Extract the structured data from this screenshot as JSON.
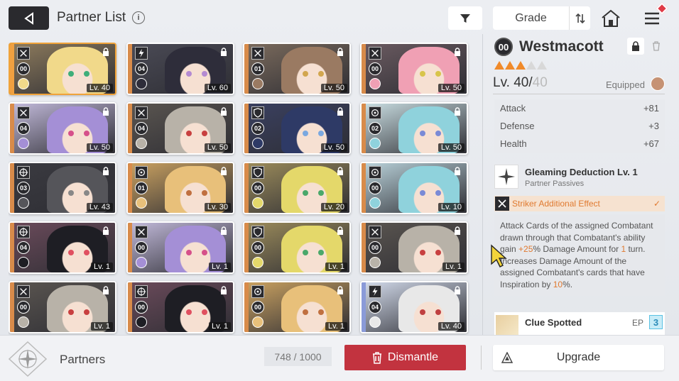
{
  "header": {
    "title": "Partner List",
    "info_symbol": "i",
    "sort_label": "Grade"
  },
  "partners": [
    {
      "grade": "00",
      "level": "Lv. 40",
      "stripe": "#f0a040",
      "hair": "#f1d98a",
      "eye": "#3fae7a",
      "bg": "#8c7a5c",
      "selected": true,
      "type": "x"
    },
    {
      "grade": "04",
      "level": "Lv. 60",
      "stripe": "#d88b4a",
      "hair": "#2e2d3a",
      "eye": "#b48ad2",
      "bg": "#4a4a55",
      "type": "bolt"
    },
    {
      "grade": "01",
      "level": "Lv. 50",
      "stripe": "#d88b4a",
      "hair": "#9a7a62",
      "eye": "#d2a64e",
      "bg": "#7a6a5c",
      "type": "x"
    },
    {
      "grade": "00",
      "level": "Lv. 50",
      "stripe": "#d88b4a",
      "hair": "#f0a0b4",
      "eye": "#d8c44a",
      "bg": "#6a5a60",
      "type": "x"
    },
    {
      "grade": "04",
      "level": "Lv. 50",
      "stripe": "#d88b4a",
      "hair": "#a48fd6",
      "eye": "#d6508a",
      "bg": "#c0b8d8",
      "type": "x"
    },
    {
      "grade": "04",
      "level": "Lv. 50",
      "stripe": "#d88b4a",
      "hair": "#b8b2a8",
      "eye": "#c84040",
      "bg": "#5a5550",
      "type": "x"
    },
    {
      "grade": "02",
      "level": "Lv. 50",
      "stripe": "#d88b4a",
      "hair": "#2e3a66",
      "eye": "#7aa8e0",
      "bg": "#3a4060",
      "type": "shield"
    },
    {
      "grade": "02",
      "level": "Lv. 50",
      "stripe": "#d88b4a",
      "hair": "#8fd2dc",
      "eye": "#7a8ad6",
      "bg": "#c8dce0",
      "type": "circle"
    },
    {
      "grade": "03",
      "level": "Lv. 43",
      "stripe": "#d88b4a",
      "hair": "#55555a",
      "eye": "#888888",
      "bg": "#3a3a40",
      "type": "target"
    },
    {
      "grade": "01",
      "level": "Lv. 30",
      "stripe": "#d88b4a",
      "hair": "#e8c07a",
      "eye": "#c07040",
      "bg": "#c8a060",
      "type": "circle"
    },
    {
      "grade": "00",
      "level": "Lv. 20",
      "stripe": "#d88b4a",
      "hair": "#e4d86a",
      "eye": "#4aa86a",
      "bg": "#9a8a5a",
      "type": "shield"
    },
    {
      "grade": "00",
      "level": "Lv. 10",
      "stripe": "#d88b4a",
      "hair": "#8fd2dc",
      "eye": "#7a8ad6",
      "bg": "#b8d0d8",
      "type": "circle"
    },
    {
      "grade": "04",
      "level": "Lv. 1",
      "stripe": "#d88b4a",
      "hair": "#1e1e24",
      "eye": "#e05060",
      "bg": "#6a4a5a",
      "type": "target"
    },
    {
      "grade": "00",
      "level": "Lv. 1",
      "stripe": "#d88b4a",
      "hair": "#a48fd6",
      "eye": "#d6508a",
      "bg": "#c0b8d8",
      "type": "x"
    },
    {
      "grade": "00",
      "level": "Lv. 1",
      "stripe": "#d88b4a",
      "hair": "#e4d86a",
      "eye": "#4aa86a",
      "bg": "#9a8a5a",
      "type": "shield"
    },
    {
      "grade": "00",
      "level": "Lv. 1",
      "stripe": "#d88b4a",
      "hair": "#b8b2a8",
      "eye": "#c84040",
      "bg": "#5a5550",
      "type": "x"
    },
    {
      "grade": "00",
      "level": "Lv. 1",
      "stripe": "#d88b4a",
      "hair": "#b8b2a8",
      "eye": "#c84040",
      "bg": "#5a5550",
      "type": "x"
    },
    {
      "grade": "00",
      "level": "Lv. 1",
      "stripe": "#d88b4a",
      "hair": "#1e1e24",
      "eye": "#e05060",
      "bg": "#6a4a5a",
      "type": "target"
    },
    {
      "grade": "00",
      "level": "Lv. 1",
      "stripe": "#d88b4a",
      "hair": "#e8c07a",
      "eye": "#c07040",
      "bg": "#c8a060",
      "type": "circle"
    },
    {
      "grade": "04",
      "level": "Lv. 40",
      "stripe": "#8a9ad8",
      "hair": "#e8e8e8",
      "eye": "#c04040",
      "bg": "#d0d8e8",
      "type": "bolt"
    }
  ],
  "detail": {
    "grade": "00",
    "name": "Westmacott",
    "stars_filled": 3,
    "stars_total": 5,
    "level_current": "Lv. 40/",
    "level_max": "40",
    "equipped_label": "Equipped",
    "stats": [
      {
        "label": "Attack",
        "value": "+81"
      },
      {
        "label": "Defense",
        "value": "+3"
      },
      {
        "label": "Health",
        "value": "+67"
      }
    ],
    "passive_name": "Gleaming Deduction Lv. 1",
    "passive_sub": "Partner Passives",
    "effect_label": "Striker Additional Effect",
    "effect_check": "✓",
    "desc": {
      "p1": "Attack Cards of the assigned Combatant drawn through that Combatant's ability gain ",
      "v1": "+25",
      "p2": "% Damage Amount for ",
      "v2": "1",
      "p3": " turn. Increases Damage Amount of the assigned Combatant's cards that have Inspiration by ",
      "v3": "10",
      "p4": "%."
    },
    "clue_name": "Clue Spotted",
    "clue_ep": "EP",
    "clue_num": "3"
  },
  "footer": {
    "label": "Partners",
    "count": "748 / 1000",
    "dismantle": "Dismantle",
    "upgrade": "Upgrade"
  },
  "colors": {
    "accent_orange": "#e07a30",
    "dismantle_red": "#c2333f",
    "selected_border": "#f0a33a"
  }
}
